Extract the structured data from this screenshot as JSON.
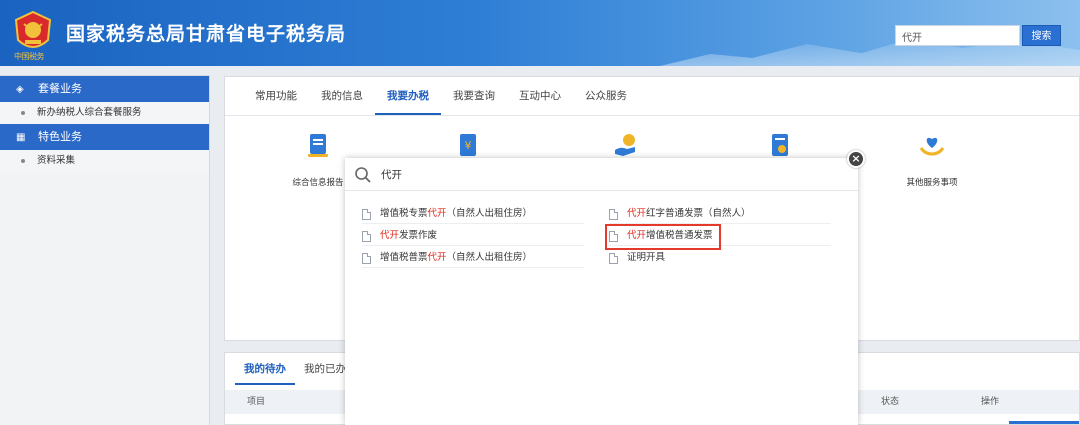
{
  "header": {
    "title": "国家税务总局甘肃省电子税务局",
    "emblem_caption": "中国税务",
    "search_value": "代开",
    "search_button": "搜索"
  },
  "sidebar": {
    "groups": [
      {
        "label": "套餐业务",
        "icon": "layers-icon",
        "items": [
          "新办纳税人综合套餐服务"
        ]
      },
      {
        "label": "特色业务",
        "icon": "grid-icon",
        "items": [
          "资料采集"
        ]
      }
    ]
  },
  "main": {
    "tabs": [
      "常用功能",
      "我的信息",
      "我要办税",
      "我要查询",
      "互动中心",
      "公众服务"
    ],
    "active_tab": "我要办税",
    "services": [
      {
        "label": "综合信息报告",
        "icon": "document-icon"
      },
      {
        "label": "",
        "icon": "invoice-icon"
      },
      {
        "label": "",
        "icon": "hand-coin-icon"
      },
      {
        "label": "",
        "icon": "certificate-icon"
      },
      {
        "label": "其他服务事项",
        "icon": "heart-hand-icon"
      }
    ],
    "bottom_tabs": [
      "我的待办",
      "我的已办"
    ],
    "table_columns": [
      "项目",
      "状态",
      "操作"
    ]
  },
  "modal": {
    "query": "代开",
    "results_left": [
      {
        "before": "增值税专票",
        "hl": "代开",
        "after": "（自然人出租住房）"
      },
      {
        "before": "",
        "hl": "代开",
        "after": "发票作废"
      },
      {
        "before": "增值税普票",
        "hl": "代开",
        "after": "（自然人出租住房）"
      }
    ],
    "results_right": [
      {
        "before": "",
        "hl": "代开",
        "after": "红字普通发票（自然人）"
      },
      {
        "before": "",
        "hl": "代开",
        "after": "增值税普通发票"
      },
      {
        "before": "证明开具",
        "hl": "",
        "after": ""
      }
    ],
    "highlight_color": "#e0281a"
  }
}
